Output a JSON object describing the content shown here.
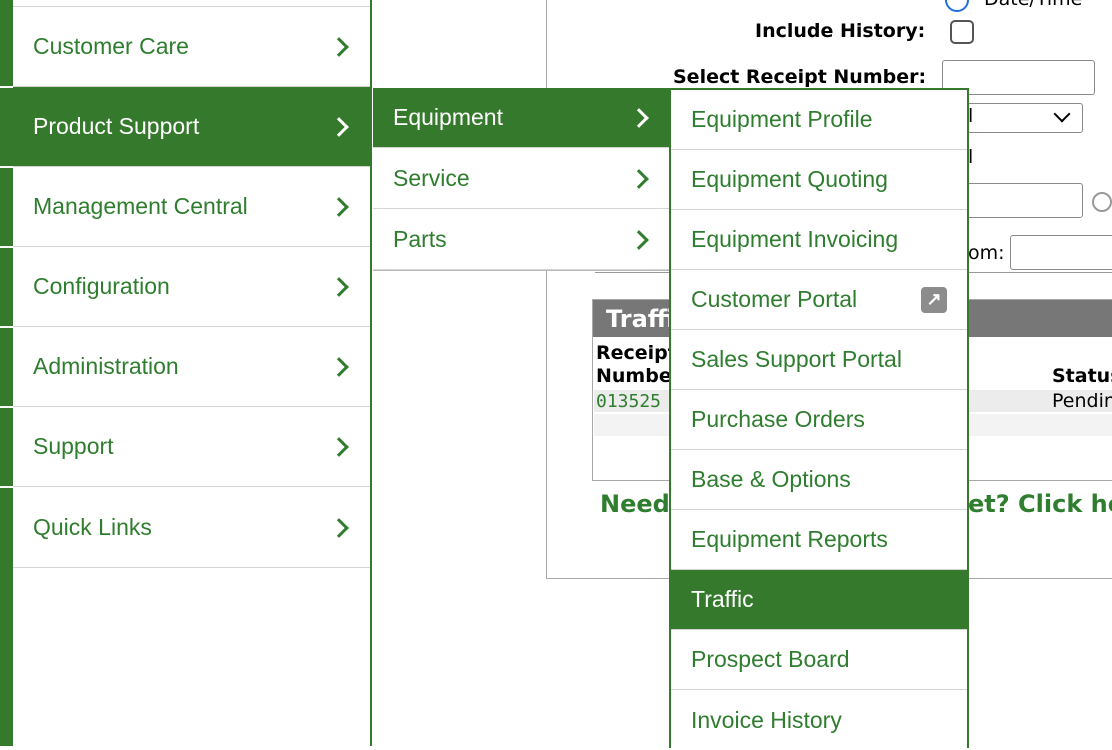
{
  "form": {
    "date_time_label": "Date/Time",
    "include_history_label": "Include History:",
    "select_receipt_label": "Select Receipt Number:",
    "from_fragment": "om:",
    "select_fragment": "l",
    "field_fragment": "l"
  },
  "traffic_table": {
    "title": "Traffic",
    "col_receipt": "Receipt Number",
    "col_status": "Status",
    "row_receipt": "013525",
    "row_status": "Pending",
    "help_prefix": "Need",
    "help_suffix": "et? Click here"
  },
  "menu": {
    "level1": [
      {
        "label": "Customer Care"
      },
      {
        "label": "Product Support",
        "active": true
      },
      {
        "label": "Management Central"
      },
      {
        "label": "Configuration"
      },
      {
        "label": "Administration"
      },
      {
        "label": "Support"
      },
      {
        "label": "Quick Links"
      }
    ],
    "level2": [
      {
        "label": "Equipment",
        "active": true
      },
      {
        "label": "Service"
      },
      {
        "label": "Parts"
      }
    ],
    "level3": [
      {
        "label": "Equipment Profile"
      },
      {
        "label": "Equipment Quoting"
      },
      {
        "label": "Equipment Invoicing"
      },
      {
        "label": "Customer Portal",
        "icon": "external-link-icon"
      },
      {
        "label": "Sales Support Portal"
      },
      {
        "label": "Purchase Orders"
      },
      {
        "label": "Base & Options"
      },
      {
        "label": "Equipment Reports"
      },
      {
        "label": "Traffic",
        "active": true
      },
      {
        "label": "Prospect Board"
      },
      {
        "label": "Invoice History"
      }
    ]
  },
  "colors": {
    "accent": "#357a2c",
    "link": "#2f7d2f",
    "table_header": "#777777"
  }
}
